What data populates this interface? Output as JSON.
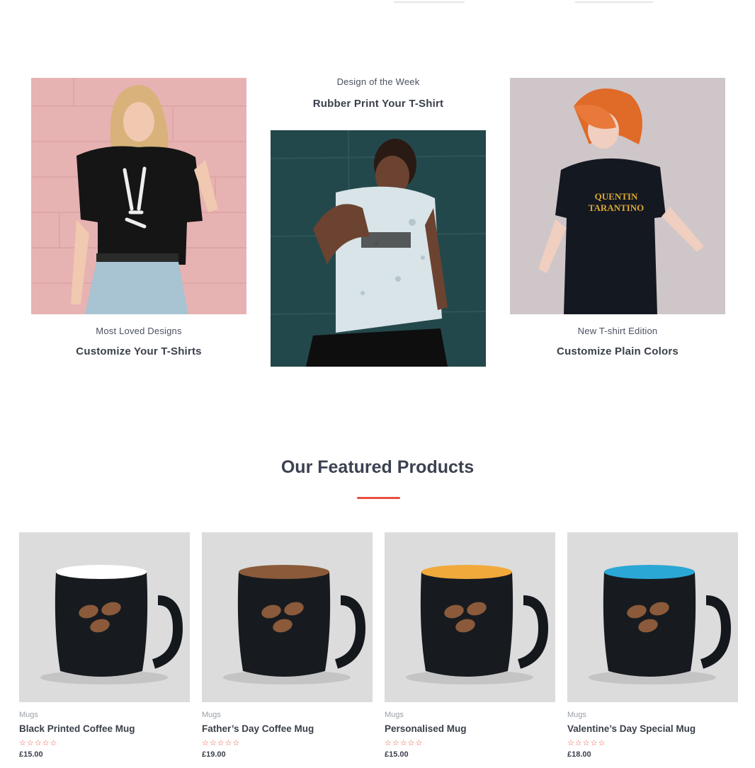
{
  "promo_cards": [
    {
      "eyebrow": "Most Loved Designs",
      "title": "Customize Your T-Shirts",
      "image": "woman-skeleton-hand-tshirt"
    },
    {
      "eyebrow": "Design of the Week",
      "title": "Rubber Print Your T-Shirt",
      "image": "man-printed-tshirt"
    },
    {
      "eyebrow": "New T-shirt Edition",
      "title": "Customize Plain Colors",
      "image": "woman-orange-hair-black-tshirt"
    }
  ],
  "featured": {
    "title": "Our Featured Products",
    "accent_color": "#e8503d",
    "products": [
      {
        "category": "Mugs",
        "name": "Black Printed Coffee Mug",
        "rating": "☆☆☆☆☆",
        "price": "£15.00",
        "inner_color": "#ffffff"
      },
      {
        "category": "Mugs",
        "name": "Father’s Day Coffee Mug",
        "rating": "☆☆☆☆☆",
        "price": "£19.00",
        "inner_color": "#8a5a3a"
      },
      {
        "category": "Mugs",
        "name": "Personalised Mug",
        "rating": "☆☆☆☆☆",
        "price": "£15.00",
        "inner_color": "#f2a93b"
      },
      {
        "category": "Mugs",
        "name": "Valentine’s Day Special Mug",
        "rating": "☆☆☆☆☆",
        "price": "£18.00",
        "inner_color": "#2ba7d6"
      }
    ]
  }
}
